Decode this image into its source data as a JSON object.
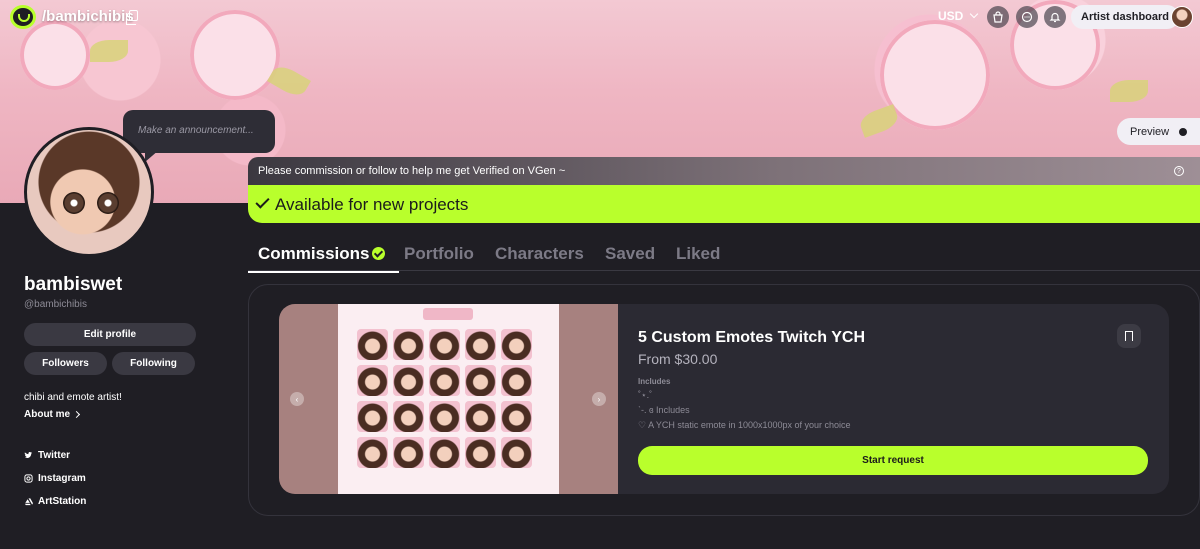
{
  "nav": {
    "handle": "/bambichibis",
    "currency": "USD",
    "artist_dashboard": "Artist dashboard"
  },
  "announcement": {
    "placeholder": "Make an announcement..."
  },
  "preview": {
    "label": "Preview"
  },
  "profile": {
    "username": "bambiswet",
    "handle": "@bambichibis",
    "edit_profile": "Edit profile",
    "followers": "Followers",
    "following": "Following",
    "bio": "chibi and emote artist!",
    "about_me": "About me",
    "socials": [
      {
        "label": "Twitter",
        "icon": "twitter-icon"
      },
      {
        "label": "Instagram",
        "icon": "instagram-icon"
      },
      {
        "label": "ArtStation",
        "icon": "artstation-icon"
      }
    ]
  },
  "notice": {
    "text": "Please commission or follow to help me get Verified on VGen ~"
  },
  "status": {
    "text": "Available for new projects",
    "color": "#b9ff2c"
  },
  "tabs": [
    {
      "label": "Commissions",
      "active": true
    },
    {
      "label": "Portfolio"
    },
    {
      "label": "Characters"
    },
    {
      "label": "Saved"
    },
    {
      "label": "Liked"
    }
  ],
  "commission": {
    "title": "5 Custom Emotes Twitch YCH",
    "price": "From $30.00",
    "includes_label": "Includes",
    "includes": [
      "˚⋆.˚",
      "ˋ-. ɞ Includes",
      "♡ A YCH static emote in 1000x1000px of your choice"
    ],
    "start_request": "Start request"
  },
  "colors": {
    "accent": "#b9ff2c",
    "background": "#1f1e24",
    "card": "#2b2a33"
  }
}
